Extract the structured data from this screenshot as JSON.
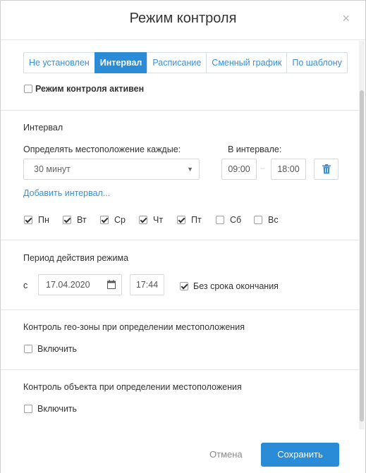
{
  "dialog": {
    "title": "Режим контроля",
    "close_glyph": "×"
  },
  "mode_tabs": [
    {
      "label": "Не установлен",
      "active": false
    },
    {
      "label": "Интервал",
      "active": true
    },
    {
      "label": "Расписание",
      "active": false
    },
    {
      "label": "Сменный график",
      "active": false
    },
    {
      "label": "По шаблону",
      "active": false
    }
  ],
  "mode_active": {
    "label": "Режим контроля активен",
    "checked": false
  },
  "interval": {
    "title": "Интервал",
    "every_label": "Определять местоположение каждые:",
    "every_value": "30 минут",
    "range_label": "В интервале:",
    "from": "09:00",
    "dash": "–",
    "to": "18:00",
    "add_interval": "Добавить интервал...",
    "days": [
      {
        "label": "Пн",
        "checked": true
      },
      {
        "label": "Вт",
        "checked": true
      },
      {
        "label": "Ср",
        "checked": true
      },
      {
        "label": "Чт",
        "checked": true
      },
      {
        "label": "Пт",
        "checked": true
      },
      {
        "label": "Сб",
        "checked": false
      },
      {
        "label": "Вс",
        "checked": false
      }
    ]
  },
  "period": {
    "title": "Период действия режима",
    "from_label": "с",
    "date": "17.04.2020",
    "time": "17:44",
    "no_end_label": "Без срока окончания",
    "no_end_checked": true
  },
  "geozone": {
    "title": "Контроль гео-зоны при определении местоположения",
    "enable_label": "Включить",
    "enabled": false
  },
  "object_control": {
    "title": "Контроль объекта при определении местоположения",
    "enable_label": "Включить",
    "enabled": false
  },
  "footer": {
    "cancel_label": "Отмена",
    "save_label": "Сохранить"
  },
  "colors": {
    "accent": "#2a8bd6",
    "link": "#3a8fd9"
  }
}
